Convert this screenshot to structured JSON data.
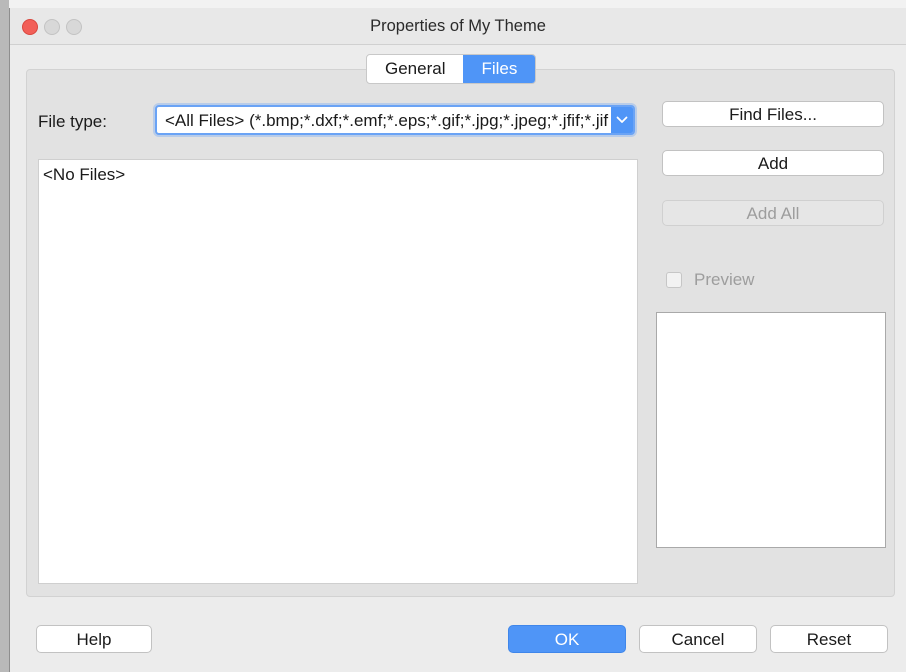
{
  "window": {
    "title": "Properties of My Theme"
  },
  "tabs": [
    {
      "label": "General",
      "active": false
    },
    {
      "label": "Files",
      "active": true
    }
  ],
  "file_type": {
    "label": "File type:",
    "value": "<All Files> (*.bmp;*.dxf;*.emf;*.eps;*.gif;*.jpg;*.jpeg;*.jfif;*.jif;*.jpe"
  },
  "file_list": {
    "items": [
      "<No Files>"
    ]
  },
  "side_buttons": {
    "find_files": "Find Files...",
    "add": "Add",
    "add_all": "Add All"
  },
  "preview": {
    "label": "Preview",
    "checked": false,
    "enabled": false
  },
  "footer": {
    "help": "Help",
    "ok": "OK",
    "cancel": "Cancel",
    "reset": "Reset"
  },
  "colors": {
    "accent": "#4f95f7",
    "close_button": "#f25f58",
    "disabled_text": "#9d9d9d"
  }
}
